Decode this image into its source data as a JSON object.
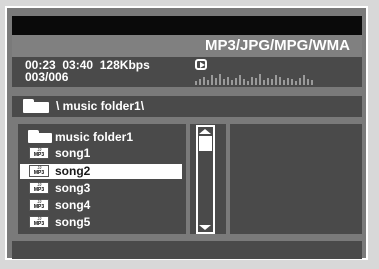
{
  "header": {
    "format_label": "MP3/JPG/MPG/WMA"
  },
  "playback": {
    "elapsed": "00:23",
    "total": "03:40",
    "bitrate": "128Kbps",
    "track_counter": "003/006",
    "state_icon": "play-icon",
    "equalizer_levels": [
      0.3,
      0.5,
      0.7,
      0.4,
      0.8,
      0.6,
      0.9,
      0.5,
      0.7,
      0.4,
      0.6,
      0.8,
      0.5,
      0.3,
      0.7,
      0.6,
      0.9,
      0.4,
      0.6,
      0.5,
      0.8,
      0.7,
      0.4,
      0.6,
      0.5,
      0.3,
      0.6,
      0.8,
      0.5,
      0.4
    ]
  },
  "path": {
    "icon": "folder-icon",
    "text": "\\ music folder1\\"
  },
  "file_list": {
    "items": [
      {
        "label": "music folder1",
        "icon": "folder-icon",
        "selected": false
      },
      {
        "label": "song1",
        "icon": "mp3-file-icon",
        "selected": false
      },
      {
        "label": "song2",
        "icon": "mp3-file-icon",
        "selected": true
      },
      {
        "label": "song3",
        "icon": "mp3-file-icon",
        "selected": false
      },
      {
        "label": "song4",
        "icon": "mp3-file-icon",
        "selected": false
      },
      {
        "label": "song5",
        "icon": "mp3-file-icon",
        "selected": false
      }
    ],
    "mp3_icon_text": "MP3",
    "mp3_icon_notes": "♪♪"
  },
  "colors": {
    "panel": "#4a4a4a",
    "frame": "#7a7a7a",
    "selection": "#ffffff",
    "text": "#ffffff"
  }
}
